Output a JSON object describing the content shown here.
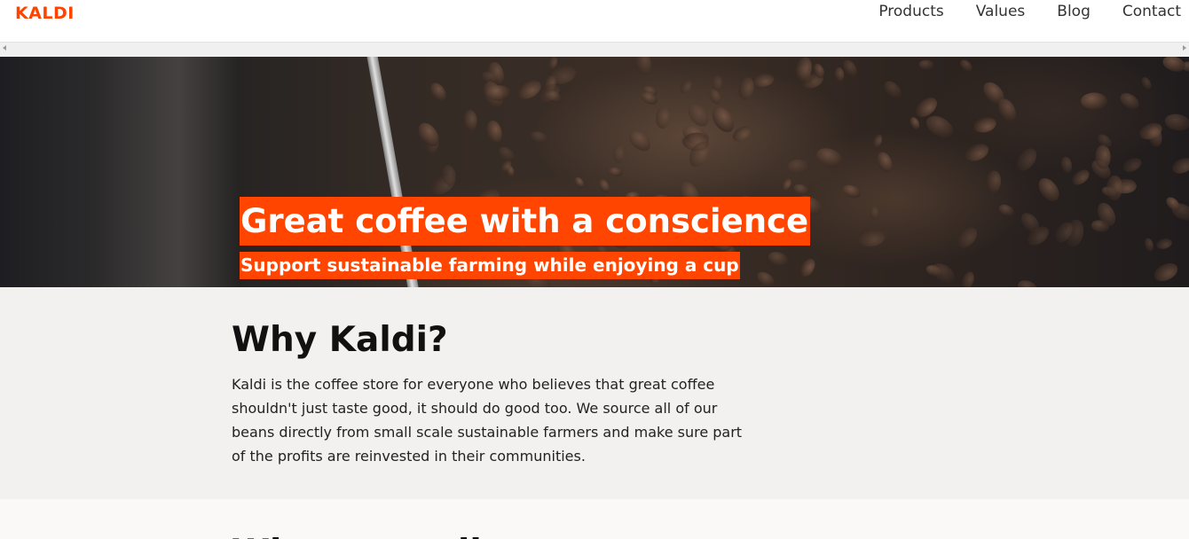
{
  "header": {
    "logo_text": "KALDI",
    "nav": [
      "Products",
      "Values",
      "Blog",
      "Contact"
    ]
  },
  "hero": {
    "title": "Great coffee with a conscience",
    "subtitle": "Support sustainable farming while enjoying a cup"
  },
  "why": {
    "heading": "Why Kaldi?",
    "body": "Kaldi is the coffee store for everyone who believes that great coffee shouldn't just taste good, it should do good too. We source all of our beans directly from small scale sustainable farmers and make sure part of the profits are reinvested in their communities."
  },
  "next_section": {
    "heading_partial": "What we sell"
  },
  "colors": {
    "brand": "#ff4500",
    "nav_text": "#333333",
    "section_bg": "#f3f1ef"
  },
  "icons": {
    "scroll_left": "triangle-left",
    "scroll_right": "triangle-right"
  }
}
